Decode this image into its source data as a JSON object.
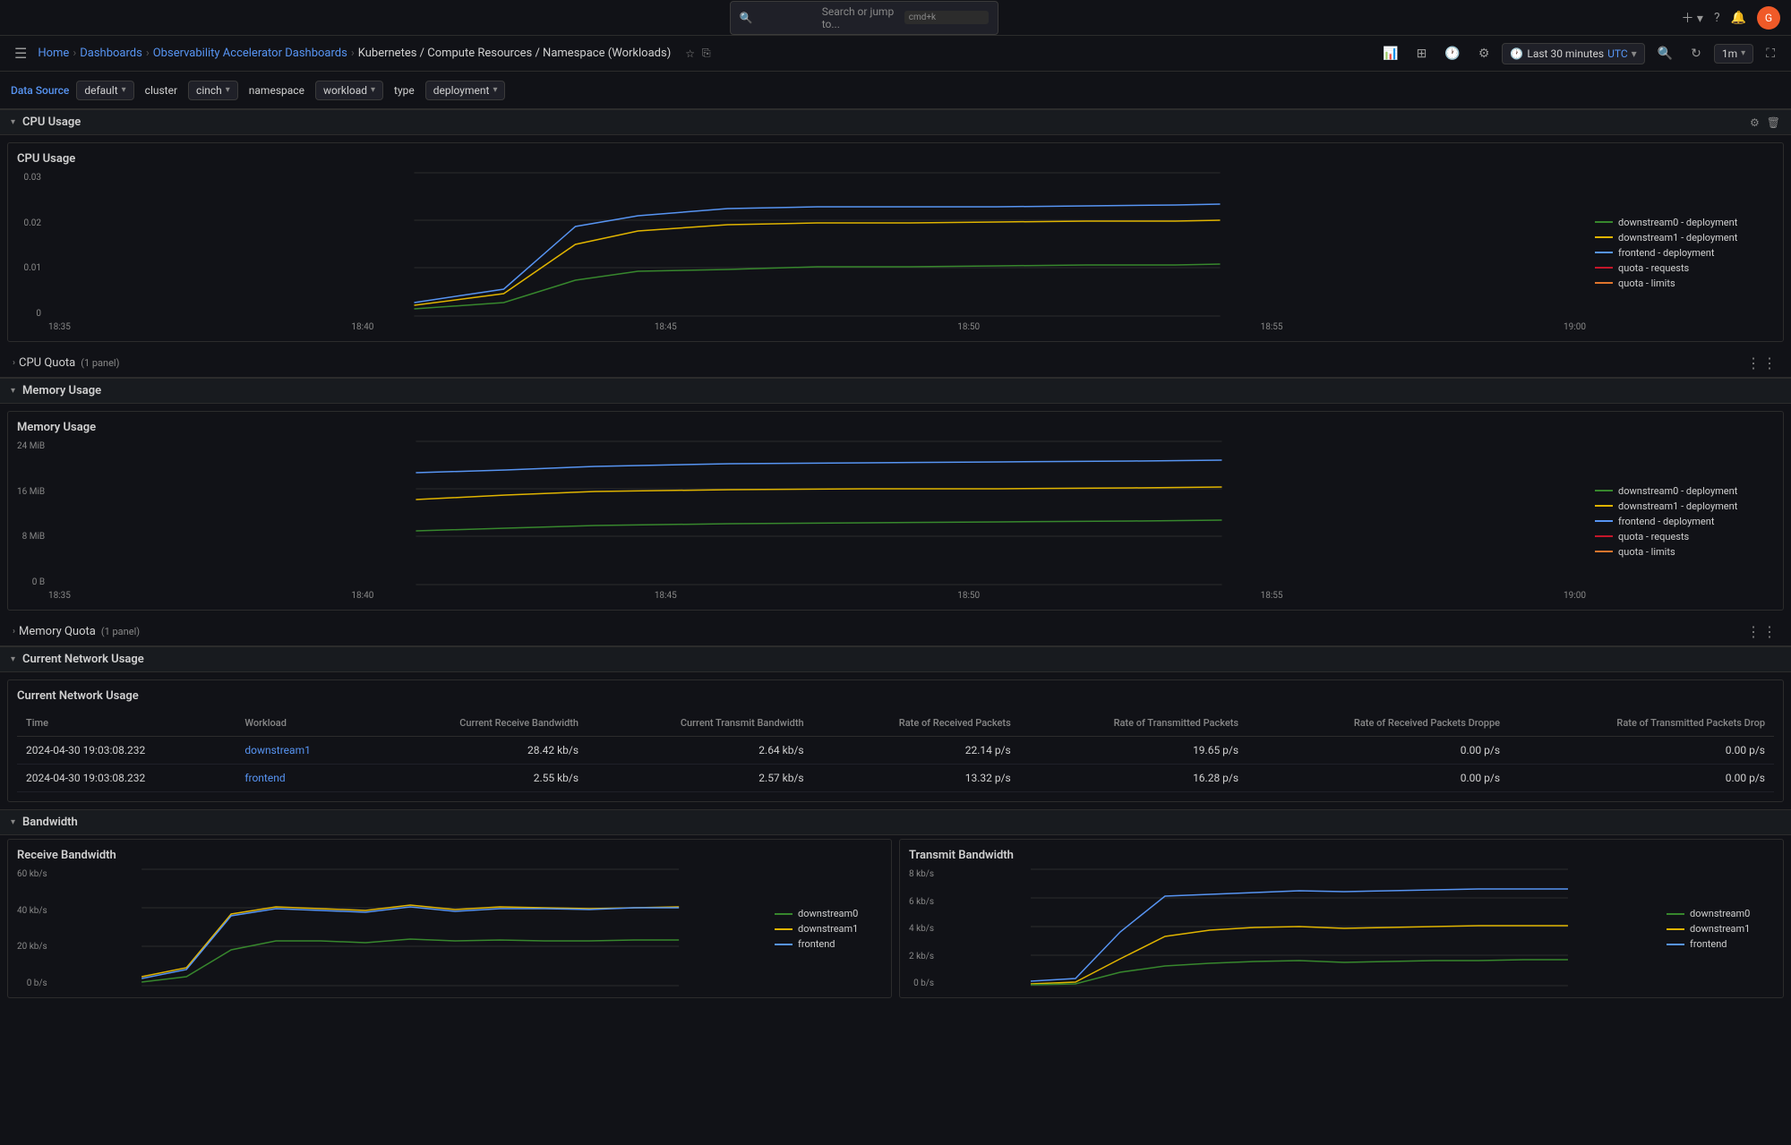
{
  "search": {
    "placeholder": "Search or jump to...",
    "shortcut": "cmd+k"
  },
  "breadcrumb": {
    "home": "Home",
    "dashboards": "Dashboards",
    "observability": "Observability Accelerator Dashboards",
    "current": "Kubernetes / Compute Resources / Namespace (Workloads)"
  },
  "timeRange": {
    "label": "Last 30 minutes",
    "timezone": "UTC",
    "refresh": "1m"
  },
  "filters": {
    "dataSource": "Data Source",
    "default": "default",
    "cluster": "cluster",
    "cinch": "cinch",
    "namespace": "namespace",
    "workload": "workload",
    "type": "type",
    "deployment": "deployment"
  },
  "sections": {
    "cpuUsage": {
      "title": "CPU Usage",
      "collapsed": false
    },
    "cpuQuota": {
      "title": "CPU Quota",
      "subtitle": "(1 panel)",
      "collapsed": true
    },
    "memoryUsage": {
      "title": "Memory Usage",
      "collapsed": false
    },
    "memoryQuota": {
      "title": "Memory Quota",
      "subtitle": "(1 panel)",
      "collapsed": true
    },
    "currentNetworkUsage": {
      "title": "Current Network Usage",
      "collapsed": false
    },
    "bandwidth": {
      "title": "Bandwidth",
      "collapsed": false
    }
  },
  "cpuChart": {
    "title": "CPU Usage",
    "yAxis": [
      "0.03",
      "0.02",
      "0.01",
      "0"
    ],
    "xAxis": [
      "18:35",
      "18:40",
      "18:45",
      "18:50",
      "18:55",
      "19:00"
    ],
    "legend": [
      {
        "label": "downstream0 - deployment",
        "color": "#37872d"
      },
      {
        "label": "downstream1 - deployment",
        "color": "#e0b400"
      },
      {
        "label": "frontend - deployment",
        "color": "#5794f2"
      },
      {
        "label": "quota - requests",
        "color": "#c4162a"
      },
      {
        "label": "quota - limits",
        "color": "#e0752d"
      }
    ]
  },
  "memoryChart": {
    "title": "Memory Usage",
    "yAxis": [
      "24 MiB",
      "16 MiB",
      "8 MiB",
      "0 B"
    ],
    "xAxis": [
      "18:35",
      "18:40",
      "18:45",
      "18:50",
      "18:55",
      "19:00"
    ],
    "legend": [
      {
        "label": "downstream0 - deployment",
        "color": "#37872d"
      },
      {
        "label": "downstream1 - deployment",
        "color": "#e0b400"
      },
      {
        "label": "frontend - deployment",
        "color": "#5794f2"
      },
      {
        "label": "quota - requests",
        "color": "#c4162a"
      },
      {
        "label": "quota - limits",
        "color": "#e0752d"
      }
    ]
  },
  "networkTable": {
    "title": "Current Network Usage",
    "columns": [
      "Time",
      "Workload",
      "Current Receive Bandwidth",
      "Current Transmit Bandwidth",
      "Rate of Received Packets",
      "Rate of Transmitted Packets",
      "Rate of Received Packets Droppe",
      "Rate of Transmitted Packets Drop"
    ],
    "rows": [
      {
        "time": "2024-04-30 19:03:08.232",
        "workload": "downstream1",
        "workloadLink": true,
        "receiveBw": "28.42 kb/s",
        "transmitBw": "2.64 kb/s",
        "rxPackets": "22.14 p/s",
        "txPackets": "19.65 p/s",
        "rxDropped": "0.00 p/s",
        "txDropped": "0.00 p/s"
      },
      {
        "time": "2024-04-30 19:03:08.232",
        "workload": "frontend",
        "workloadLink": true,
        "receiveBw": "2.55 kb/s",
        "transmitBw": "2.57 kb/s",
        "rxPackets": "13.32 p/s",
        "txPackets": "16.28 p/s",
        "rxDropped": "0.00 p/s",
        "txDropped": "0.00 p/s"
      }
    ]
  },
  "receiveBandwidth": {
    "title": "Receive Bandwidth",
    "yAxis": [
      "60 kb/s",
      "40 kb/s",
      "20 kb/s",
      "0 b/s"
    ],
    "legend": [
      {
        "label": "downstream0",
        "color": "#37872d"
      },
      {
        "label": "downstream1",
        "color": "#e0b400"
      },
      {
        "label": "frontend",
        "color": "#5794f2"
      }
    ]
  },
  "transmitBandwidth": {
    "title": "Transmit Bandwidth",
    "yAxis": [
      "8 kb/s",
      "6 kb/s",
      "4 kb/s",
      "2 kb/s",
      "0 b/s"
    ],
    "legend": [
      {
        "label": "downstream0",
        "color": "#37872d"
      },
      {
        "label": "downstream1",
        "color": "#e0b400"
      },
      {
        "label": "frontend",
        "color": "#5794f2"
      }
    ]
  }
}
